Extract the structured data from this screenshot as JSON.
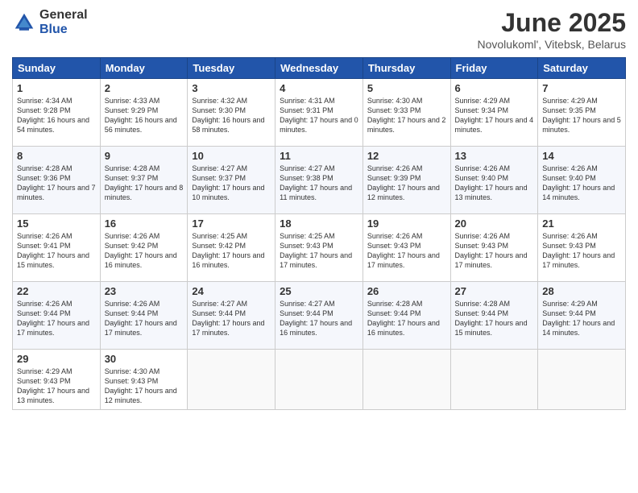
{
  "logo": {
    "general": "General",
    "blue": "Blue"
  },
  "title": "June 2025",
  "subtitle": "Novolukoml', Vitebsk, Belarus",
  "days": [
    "Sunday",
    "Monday",
    "Tuesday",
    "Wednesday",
    "Thursday",
    "Friday",
    "Saturday"
  ],
  "weeks": [
    [
      {
        "num": "1",
        "sunrise": "Sunrise: 4:34 AM",
        "sunset": "Sunset: 9:28 PM",
        "daylight": "Daylight: 16 hours and 54 minutes."
      },
      {
        "num": "2",
        "sunrise": "Sunrise: 4:33 AM",
        "sunset": "Sunset: 9:29 PM",
        "daylight": "Daylight: 16 hours and 56 minutes."
      },
      {
        "num": "3",
        "sunrise": "Sunrise: 4:32 AM",
        "sunset": "Sunset: 9:30 PM",
        "daylight": "Daylight: 16 hours and 58 minutes."
      },
      {
        "num": "4",
        "sunrise": "Sunrise: 4:31 AM",
        "sunset": "Sunset: 9:31 PM",
        "daylight": "Daylight: 17 hours and 0 minutes."
      },
      {
        "num": "5",
        "sunrise": "Sunrise: 4:30 AM",
        "sunset": "Sunset: 9:33 PM",
        "daylight": "Daylight: 17 hours and 2 minutes."
      },
      {
        "num": "6",
        "sunrise": "Sunrise: 4:29 AM",
        "sunset": "Sunset: 9:34 PM",
        "daylight": "Daylight: 17 hours and 4 minutes."
      },
      {
        "num": "7",
        "sunrise": "Sunrise: 4:29 AM",
        "sunset": "Sunset: 9:35 PM",
        "daylight": "Daylight: 17 hours and 5 minutes."
      }
    ],
    [
      {
        "num": "8",
        "sunrise": "Sunrise: 4:28 AM",
        "sunset": "Sunset: 9:36 PM",
        "daylight": "Daylight: 17 hours and 7 minutes."
      },
      {
        "num": "9",
        "sunrise": "Sunrise: 4:28 AM",
        "sunset": "Sunset: 9:37 PM",
        "daylight": "Daylight: 17 hours and 8 minutes."
      },
      {
        "num": "10",
        "sunrise": "Sunrise: 4:27 AM",
        "sunset": "Sunset: 9:37 PM",
        "daylight": "Daylight: 17 hours and 10 minutes."
      },
      {
        "num": "11",
        "sunrise": "Sunrise: 4:27 AM",
        "sunset": "Sunset: 9:38 PM",
        "daylight": "Daylight: 17 hours and 11 minutes."
      },
      {
        "num": "12",
        "sunrise": "Sunrise: 4:26 AM",
        "sunset": "Sunset: 9:39 PM",
        "daylight": "Daylight: 17 hours and 12 minutes."
      },
      {
        "num": "13",
        "sunrise": "Sunrise: 4:26 AM",
        "sunset": "Sunset: 9:40 PM",
        "daylight": "Daylight: 17 hours and 13 minutes."
      },
      {
        "num": "14",
        "sunrise": "Sunrise: 4:26 AM",
        "sunset": "Sunset: 9:40 PM",
        "daylight": "Daylight: 17 hours and 14 minutes."
      }
    ],
    [
      {
        "num": "15",
        "sunrise": "Sunrise: 4:26 AM",
        "sunset": "Sunset: 9:41 PM",
        "daylight": "Daylight: 17 hours and 15 minutes."
      },
      {
        "num": "16",
        "sunrise": "Sunrise: 4:26 AM",
        "sunset": "Sunset: 9:42 PM",
        "daylight": "Daylight: 17 hours and 16 minutes."
      },
      {
        "num": "17",
        "sunrise": "Sunrise: 4:25 AM",
        "sunset": "Sunset: 9:42 PM",
        "daylight": "Daylight: 17 hours and 16 minutes."
      },
      {
        "num": "18",
        "sunrise": "Sunrise: 4:25 AM",
        "sunset": "Sunset: 9:43 PM",
        "daylight": "Daylight: 17 hours and 17 minutes."
      },
      {
        "num": "19",
        "sunrise": "Sunrise: 4:26 AM",
        "sunset": "Sunset: 9:43 PM",
        "daylight": "Daylight: 17 hours and 17 minutes."
      },
      {
        "num": "20",
        "sunrise": "Sunrise: 4:26 AM",
        "sunset": "Sunset: 9:43 PM",
        "daylight": "Daylight: 17 hours and 17 minutes."
      },
      {
        "num": "21",
        "sunrise": "Sunrise: 4:26 AM",
        "sunset": "Sunset: 9:43 PM",
        "daylight": "Daylight: 17 hours and 17 minutes."
      }
    ],
    [
      {
        "num": "22",
        "sunrise": "Sunrise: 4:26 AM",
        "sunset": "Sunset: 9:44 PM",
        "daylight": "Daylight: 17 hours and 17 minutes."
      },
      {
        "num": "23",
        "sunrise": "Sunrise: 4:26 AM",
        "sunset": "Sunset: 9:44 PM",
        "daylight": "Daylight: 17 hours and 17 minutes."
      },
      {
        "num": "24",
        "sunrise": "Sunrise: 4:27 AM",
        "sunset": "Sunset: 9:44 PM",
        "daylight": "Daylight: 17 hours and 17 minutes."
      },
      {
        "num": "25",
        "sunrise": "Sunrise: 4:27 AM",
        "sunset": "Sunset: 9:44 PM",
        "daylight": "Daylight: 17 hours and 16 minutes."
      },
      {
        "num": "26",
        "sunrise": "Sunrise: 4:28 AM",
        "sunset": "Sunset: 9:44 PM",
        "daylight": "Daylight: 17 hours and 16 minutes."
      },
      {
        "num": "27",
        "sunrise": "Sunrise: 4:28 AM",
        "sunset": "Sunset: 9:44 PM",
        "daylight": "Daylight: 17 hours and 15 minutes."
      },
      {
        "num": "28",
        "sunrise": "Sunrise: 4:29 AM",
        "sunset": "Sunset: 9:44 PM",
        "daylight": "Daylight: 17 hours and 14 minutes."
      }
    ],
    [
      {
        "num": "29",
        "sunrise": "Sunrise: 4:29 AM",
        "sunset": "Sunset: 9:43 PM",
        "daylight": "Daylight: 17 hours and 13 minutes."
      },
      {
        "num": "30",
        "sunrise": "Sunrise: 4:30 AM",
        "sunset": "Sunset: 9:43 PM",
        "daylight": "Daylight: 17 hours and 12 minutes."
      },
      null,
      null,
      null,
      null,
      null
    ]
  ]
}
